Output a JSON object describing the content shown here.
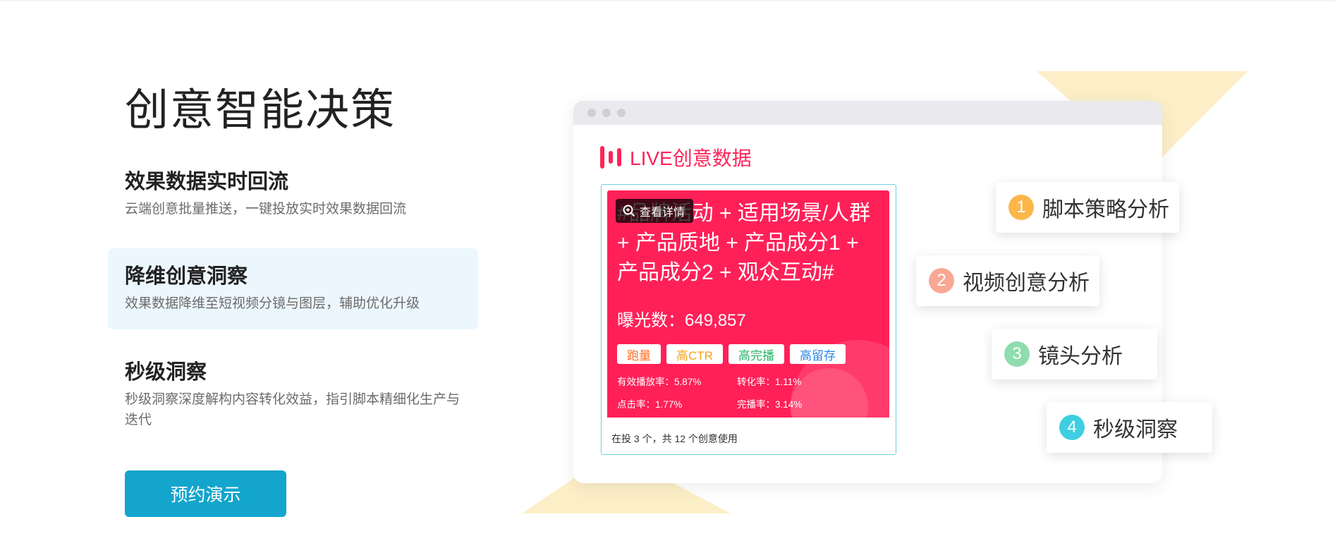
{
  "left": {
    "title": "创意智能决策",
    "features": [
      {
        "title": "效果数据实时回流",
        "desc": "云端创意批量推送，一键投放实时效果数据回流"
      },
      {
        "title": "降维创意洞察",
        "desc": "效果数据降维至短视频分镜与图层，辅助优化升级"
      },
      {
        "title": "秒级洞察",
        "desc": "秒级洞察深度解构内容转化效益，指引脚本精细化生产与迭代"
      }
    ],
    "cta": "预约演示"
  },
  "panel": {
    "header": "LIVE创意数据",
    "card": {
      "detail_label": "查看详情",
      "script_text": "#品牌活动 + 适用场景/人群 + 产品质地 + 产品成分1 + 产品成分2 + 观众互动#",
      "exposure": "曝光数：649,857",
      "tags": [
        {
          "label": "跑量",
          "color": "#ff6d1f"
        },
        {
          "label": "高CTR",
          "color": "#f5a31a"
        },
        {
          "label": "高完播",
          "color": "#29b36a"
        },
        {
          "label": "高留存",
          "color": "#2b86e8"
        }
      ],
      "metrics": [
        "有效播放率：5.87%",
        "转化率：1.11%",
        "点击率：1.77%",
        "完播率：3.14%"
      ],
      "footer": "在投 3 个，共 12 个创意使用"
    }
  },
  "analysis": [
    {
      "num": "1",
      "label": "脚本策略分析",
      "color": "#fcb64a"
    },
    {
      "num": "2",
      "label": "视频创意分析",
      "color": "#f9a894"
    },
    {
      "num": "3",
      "label": "镜头分析",
      "color": "#8fdcae"
    },
    {
      "num": "4",
      "label": "秒级洞察",
      "color": "#3dcfe0"
    }
  ]
}
